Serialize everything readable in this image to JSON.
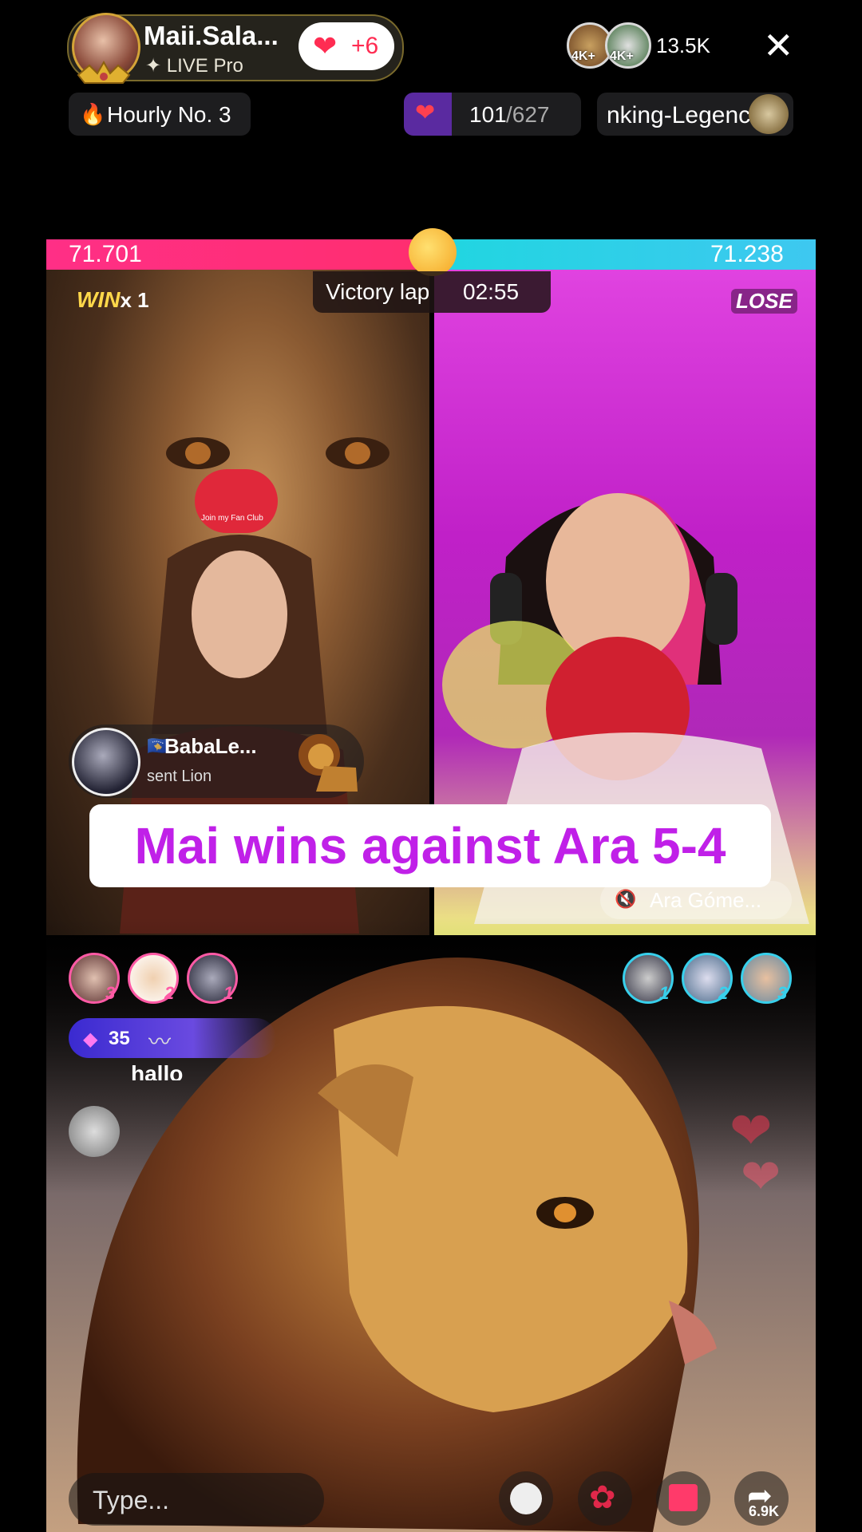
{
  "host": {
    "name": "Maii.Sala...",
    "badge": "LIVE Pro",
    "likes": "+6"
  },
  "header": {
    "viewer_badges": [
      "4K+",
      "4K+"
    ],
    "viewer_count": "13.5K",
    "hourly_rank": "Hourly No. 3",
    "fan_progress_current": "101",
    "fan_progress_total": "/627",
    "ranking_label": "nking-Legenc"
  },
  "battle": {
    "left_score": "71.701",
    "right_score": "71.238",
    "timer_label": "Victory lap",
    "timer_value": "02:55",
    "win_label": "WIN",
    "win_count": "x 1",
    "lose_label": "LOSE",
    "fan_club_label": "Join my Fan Club"
  },
  "gift_notice": {
    "flag": "🇽🇰",
    "user": "BabaLe...",
    "action": "sent Lion"
  },
  "caption": "Mai wins against Ara 5-4",
  "opponent": {
    "name": "Ara Góme..."
  },
  "top_gifters_left": [
    "3",
    "2",
    "1"
  ],
  "top_gifters_right": [
    "1",
    "2",
    "3"
  ],
  "diamonds": "35",
  "chat": {
    "partial_message": "hallo"
  },
  "composer": {
    "placeholder": "Type...",
    "share_count": "6.9K"
  },
  "colors": {
    "left_team": "#ff2f86",
    "right_team": "#20d6e0",
    "caption": "#c020e8"
  }
}
